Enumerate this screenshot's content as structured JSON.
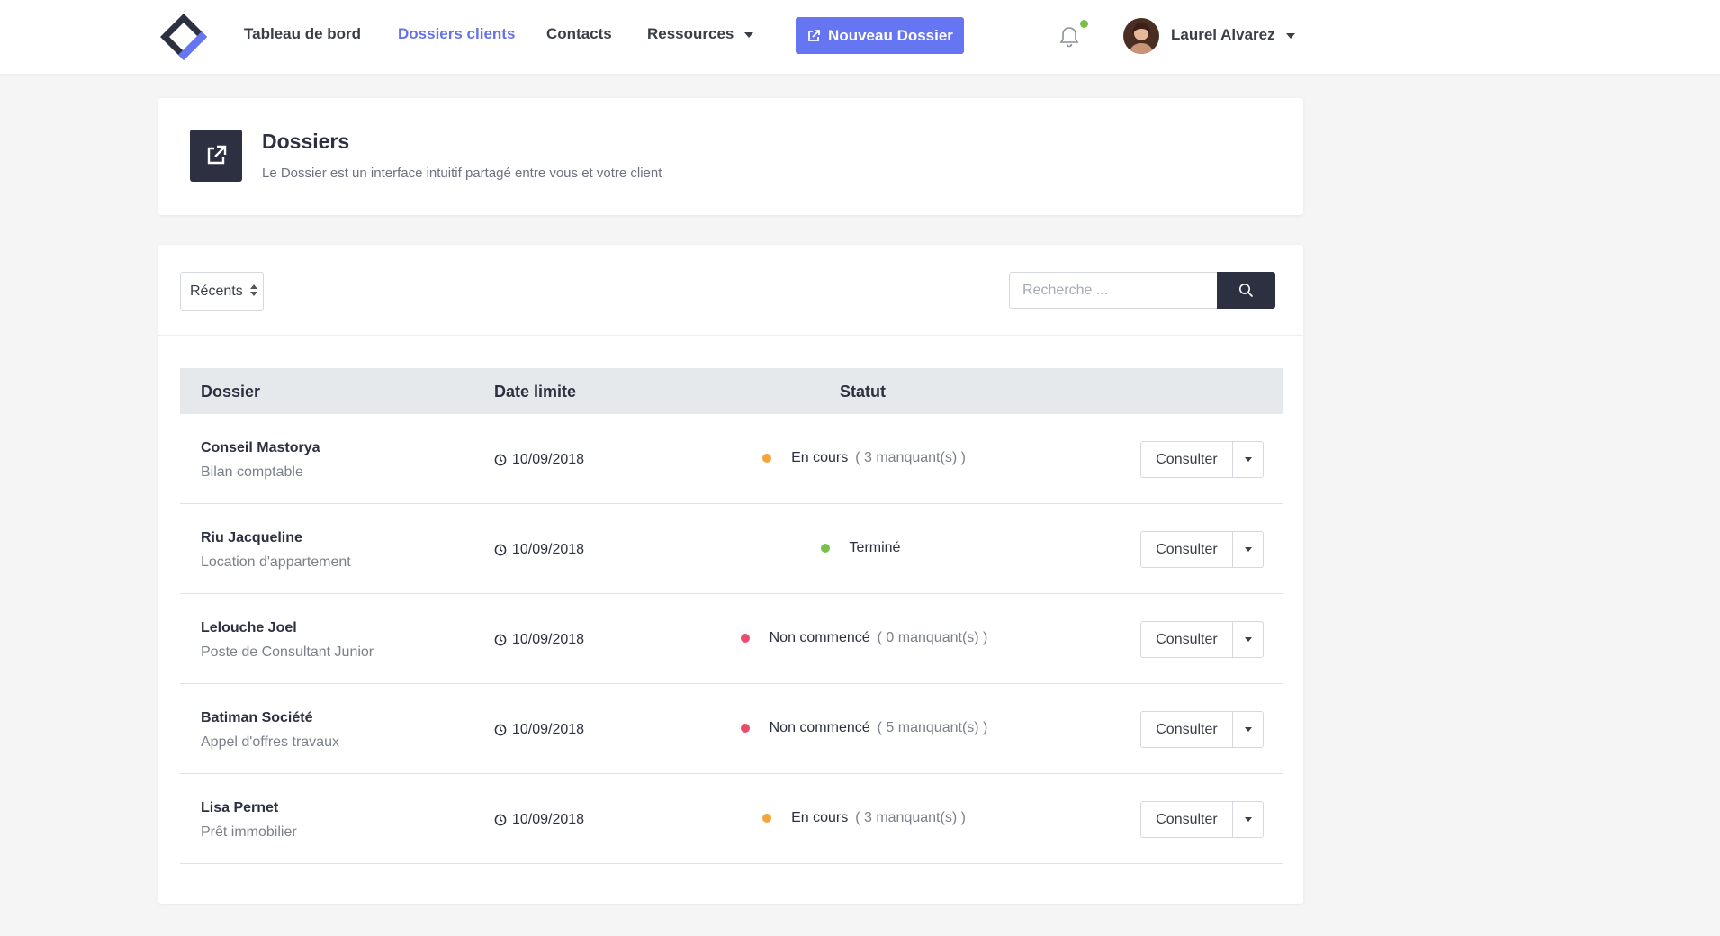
{
  "nav": {
    "links": [
      {
        "label": "Tableau de bord",
        "active": false
      },
      {
        "label": "Dossiers clients",
        "active": true
      },
      {
        "label": "Contacts",
        "active": false
      },
      {
        "label": "Ressources",
        "active": false
      }
    ],
    "new_button": "Nouveau Dossier",
    "user_name": "Laurel Alvarez",
    "notification_dot_color": "#7bbf4a"
  },
  "header": {
    "title": "Dossiers",
    "subtitle": "Le Dossier est un interface intuitif partagé entre vous et votre client"
  },
  "toolbar": {
    "sort_value": "Récents",
    "search_placeholder": "Recherche ..."
  },
  "table": {
    "columns": [
      "Dossier",
      "Date limite",
      "Statut"
    ],
    "rows": [
      {
        "name": "Conseil Mastorya",
        "type": "Bilan comptable",
        "date": "10/09/2018",
        "status": "En cours",
        "missing": "( 3 manquant(s) )",
        "color": "#f5a43a",
        "action": "Consulter"
      },
      {
        "name": "Riu Jacqueline",
        "type": "Location d'appartement",
        "date": "10/09/2018",
        "status": "Terminé",
        "missing": "",
        "color": "#7bbf4a",
        "action": "Consulter"
      },
      {
        "name": "Lelouche Joel",
        "type": "Poste de Consultant Junior",
        "date": "10/09/2018",
        "status": "Non commencé",
        "missing": "( 0 manquant(s) )",
        "color": "#ea4c6b",
        "action": "Consulter"
      },
      {
        "name": "Batiman Société",
        "type": "Appel d'offres travaux",
        "date": "10/09/2018",
        "status": "Non commencé",
        "missing": "( 5 manquant(s) )",
        "color": "#ea4c6b",
        "action": "Consulter"
      },
      {
        "name": "Lisa Pernet",
        "type": "Prêt immobilier",
        "date": "10/09/2018",
        "status": "En cours",
        "missing": "( 3 manquant(s) )",
        "color": "#f5a43a",
        "action": "Consulter"
      }
    ]
  },
  "colors": {
    "accent": "#6675f2",
    "dark": "#2c3040"
  }
}
